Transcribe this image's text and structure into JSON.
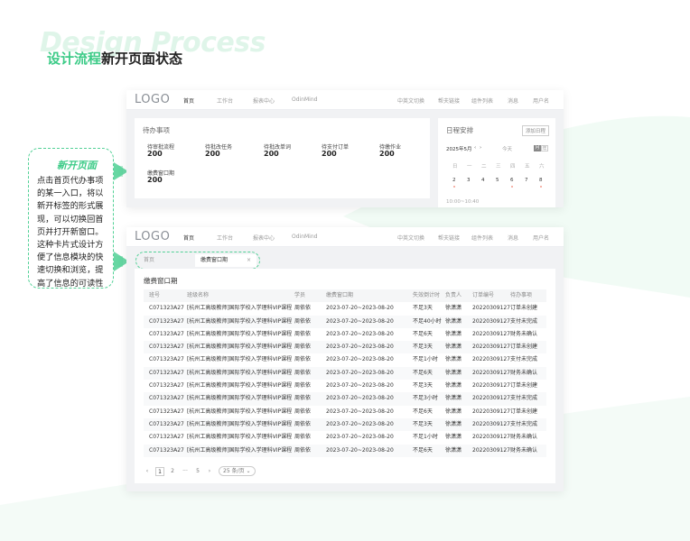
{
  "watermark": "Design Process",
  "heading": {
    "highlight": "设计流程",
    "rest": "新开页面状态"
  },
  "callout": {
    "title": "新开页面",
    "body": "点击首页代办事项的某一入口，将以新开标签的形式展现，可以切换回首页并打开新窗口。这种卡片式设计方便了信息模块的快速切换和浏览，提高了信息的可读性"
  },
  "nav": {
    "logo": "LOGO",
    "items": [
      "首页",
      "工作台",
      "报表中心",
      "OdinMind"
    ],
    "right_items": [
      "中英文切换",
      "帮夫链接",
      "组件列表",
      "消息",
      "用户名"
    ]
  },
  "todo": {
    "title": "待办事项",
    "items": [
      {
        "label": "待审批流程",
        "value": "200"
      },
      {
        "label": "待批改任务",
        "value": "200"
      },
      {
        "label": "待批改单词",
        "value": "200"
      },
      {
        "label": "待支付订单",
        "value": "200"
      },
      {
        "label": "待缴作业",
        "value": "200"
      },
      {
        "label": "缴费窗口期",
        "value": "200"
      }
    ]
  },
  "schedule": {
    "title": "日程安排",
    "add_button": "添加日程",
    "month": "2025年5月",
    "prev": "‹",
    "next": "›",
    "today": "今天",
    "view_month": "月",
    "view_year": "年",
    "weekdays": [
      "日",
      "一",
      "二",
      "三",
      "四",
      "五",
      "六"
    ],
    "days": [
      "2",
      "3",
      "4",
      "5",
      "6",
      "7",
      "8"
    ],
    "time_range": "10:00~10:40"
  },
  "tabs": {
    "home": "首页",
    "active": "缴费窗口期",
    "close": "×"
  },
  "table": {
    "title": "缴费窗口期",
    "columns": [
      "班号",
      "班级名称",
      "学员",
      "缴费窗口期",
      "失效倒计时",
      "负责人",
      "订单编号",
      "待办事项"
    ],
    "rows": [
      [
        "C071323A27",
        "[杭州工高级教师]国际学校入学理科VIP课程",
        "周依依",
        "2023-07-20~2023-08-20",
        "不足3天",
        "徐潇潇",
        "20220309127",
        "订单未创建"
      ],
      [
        "C071323A27",
        "[杭州工高级教师]国际学校入学理科VIP课程",
        "周依依",
        "2023-07-20~2023-08-20",
        "不足40小时",
        "徐潇潇",
        "20220309127",
        "支付未完成"
      ],
      [
        "C071323A27",
        "[杭州工高级教师]国际学校入学理科VIP课程",
        "周依依",
        "2023-07-20~2023-08-20",
        "不足6天",
        "徐潇潇",
        "20220309127",
        "财务未确认"
      ],
      [
        "C071323A27",
        "[杭州工高级教师]国际学校入学理科VIP课程",
        "周依依",
        "2023-07-20~2023-08-20",
        "不足3天",
        "徐潇潇",
        "20220309127",
        "订单未创建"
      ],
      [
        "C071323A27",
        "[杭州工高级教师]国际学校入学理科VIP课程",
        "周依依",
        "2023-07-20~2023-08-20",
        "不足1小时",
        "徐潇潇",
        "20220309127",
        "支付未完成"
      ],
      [
        "C071323A27",
        "[杭州工高级教师]国际学校入学理科VIP课程",
        "周依依",
        "2023-07-20~2023-08-20",
        "不足6天",
        "徐潇潇",
        "20220309127",
        "财务未确认"
      ],
      [
        "C071323A27",
        "[杭州工高级教师]国际学校入学理科VIP课程",
        "周依依",
        "2023-07-20~2023-08-20",
        "不足3天",
        "徐潇潇",
        "20220309127",
        "订单未创建"
      ],
      [
        "C071323A27",
        "[杭州工高级教师]国际学校入学理科VIP课程",
        "周依依",
        "2023-07-20~2023-08-20",
        "不足3小时",
        "徐潇潇",
        "20220309127",
        "支付未完成"
      ],
      [
        "C071323A27",
        "[杭州工高级教师]国际学校入学理科VIP课程",
        "周依依",
        "2023-07-20~2023-08-20",
        "不足6天",
        "徐潇潇",
        "20220309127",
        "订单未创建"
      ],
      [
        "C071323A27",
        "[杭州工高级教师]国际学校入学理科VIP课程",
        "周依依",
        "2023-07-20~2023-08-20",
        "不足3天",
        "徐潇潇",
        "20220309127",
        "支付未完成"
      ],
      [
        "C071323A27",
        "[杭州工高级教师]国际学校入学理科VIP课程",
        "周依依",
        "2023-07-20~2023-08-20",
        "不足1小时",
        "徐潇潇",
        "20220309127",
        "财务未确认"
      ],
      [
        "C071323A27",
        "[杭州工高级教师]国际学校入学理科VIP课程",
        "周依依",
        "2023-07-20~2023-08-20",
        "不足6天",
        "徐潇潇",
        "20220309127",
        "财务未确认"
      ]
    ]
  },
  "pagination": {
    "prev": "‹",
    "pages": [
      "1",
      "2",
      "···",
      "5"
    ],
    "next": "›",
    "page_size": "25 条/页"
  },
  "colors": {
    "accent": "#3ccb87",
    "dashed": "#52d196"
  }
}
